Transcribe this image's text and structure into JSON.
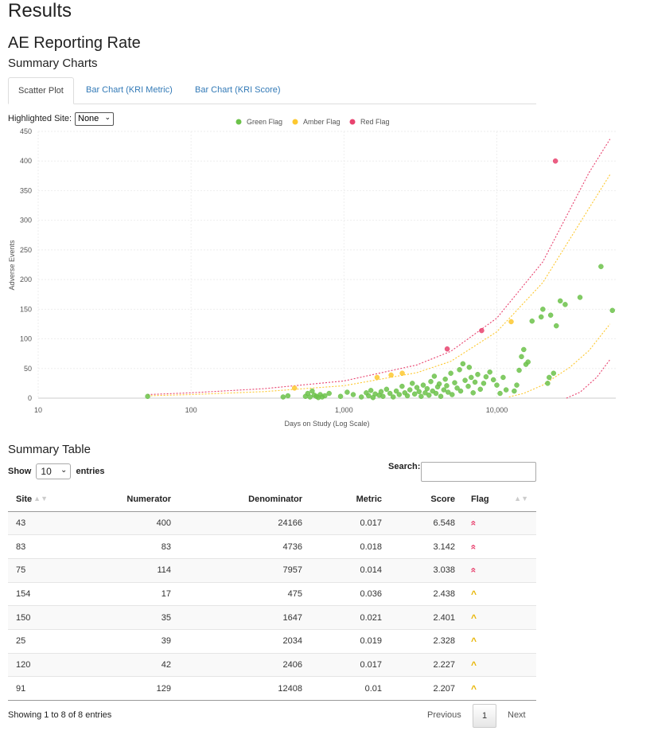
{
  "page": {
    "title": "Results",
    "subtitle": "AE Reporting Rate",
    "charts_heading": "Summary Charts",
    "table_heading": "Summary Table"
  },
  "tabs": [
    {
      "label": "Scatter Plot",
      "active": true
    },
    {
      "label": "Bar Chart (KRI Metric)",
      "active": false
    },
    {
      "label": "Bar Chart (KRI Score)",
      "active": false
    }
  ],
  "highlight": {
    "label": "Highlighted Site:",
    "selected": "None"
  },
  "colors": {
    "green": "#6cc24a",
    "amber": "#fdc82f",
    "red": "#e8436f",
    "link": "#337ab7"
  },
  "chart_data": {
    "type": "scatter",
    "xlabel": "Days on Study (Log Scale)",
    "ylabel": "Adverse Events",
    "x_scale": "log",
    "xlim": [
      10,
      60000
    ],
    "ylim": [
      0,
      450
    ],
    "x_ticks": [
      10,
      100,
      1000,
      10000
    ],
    "x_tick_labels": [
      "10",
      "100",
      "1,000",
      "10,000"
    ],
    "y_ticks": [
      0,
      50,
      100,
      150,
      200,
      250,
      300,
      350,
      400,
      450
    ],
    "grid": true,
    "legend": {
      "placement": "top-center",
      "entries": [
        {
          "name": "Green Flag",
          "color": "#6cc24a"
        },
        {
          "name": "Amber Flag",
          "color": "#fdc82f"
        },
        {
          "name": "Red Flag",
          "color": "#e8436f"
        }
      ]
    },
    "series": [
      {
        "name": "Red Flag",
        "color": "#e8436f",
        "points": [
          {
            "x": 24166,
            "y": 400
          },
          {
            "x": 4736,
            "y": 83
          },
          {
            "x": 7957,
            "y": 114
          }
        ]
      },
      {
        "name": "Amber Flag",
        "color": "#fdc82f",
        "points": [
          {
            "x": 475,
            "y": 17
          },
          {
            "x": 1647,
            "y": 35
          },
          {
            "x": 2034,
            "y": 39
          },
          {
            "x": 2406,
            "y": 42
          },
          {
            "x": 12408,
            "y": 129
          }
        ]
      },
      {
        "name": "Green Flag",
        "color": "#6cc24a",
        "points": [
          {
            "x": 52,
            "y": 3
          },
          {
            "x": 400,
            "y": 2
          },
          {
            "x": 430,
            "y": 4
          },
          {
            "x": 560,
            "y": 3
          },
          {
            "x": 580,
            "y": 8
          },
          {
            "x": 600,
            "y": 2
          },
          {
            "x": 620,
            "y": 12
          },
          {
            "x": 640,
            "y": 5
          },
          {
            "x": 660,
            "y": 3
          },
          {
            "x": 680,
            "y": 1
          },
          {
            "x": 700,
            "y": 6
          },
          {
            "x": 720,
            "y": 2
          },
          {
            "x": 750,
            "y": 4
          },
          {
            "x": 800,
            "y": 8
          },
          {
            "x": 950,
            "y": 3
          },
          {
            "x": 1050,
            "y": 10
          },
          {
            "x": 1150,
            "y": 6
          },
          {
            "x": 1300,
            "y": 2
          },
          {
            "x": 1400,
            "y": 9
          },
          {
            "x": 1450,
            "y": 4
          },
          {
            "x": 1500,
            "y": 13
          },
          {
            "x": 1550,
            "y": 1
          },
          {
            "x": 1600,
            "y": 7
          },
          {
            "x": 1700,
            "y": 5
          },
          {
            "x": 1750,
            "y": 11
          },
          {
            "x": 1800,
            "y": 3
          },
          {
            "x": 1900,
            "y": 15
          },
          {
            "x": 2000,
            "y": 8
          },
          {
            "x": 2100,
            "y": 2
          },
          {
            "x": 2200,
            "y": 12
          },
          {
            "x": 2300,
            "y": 6
          },
          {
            "x": 2400,
            "y": 20
          },
          {
            "x": 2500,
            "y": 9
          },
          {
            "x": 2600,
            "y": 4
          },
          {
            "x": 2700,
            "y": 14
          },
          {
            "x": 2800,
            "y": 25
          },
          {
            "x": 2900,
            "y": 7
          },
          {
            "x": 3000,
            "y": 18
          },
          {
            "x": 3100,
            "y": 11
          },
          {
            "x": 3200,
            "y": 3
          },
          {
            "x": 3300,
            "y": 22
          },
          {
            "x": 3400,
            "y": 9
          },
          {
            "x": 3500,
            "y": 16
          },
          {
            "x": 3600,
            "y": 5
          },
          {
            "x": 3700,
            "y": 28
          },
          {
            "x": 3800,
            "y": 12
          },
          {
            "x": 3900,
            "y": 37
          },
          {
            "x": 4000,
            "y": 8
          },
          {
            "x": 4100,
            "y": 19
          },
          {
            "x": 4200,
            "y": 24
          },
          {
            "x": 4300,
            "y": 3
          },
          {
            "x": 4500,
            "y": 14
          },
          {
            "x": 4600,
            "y": 32
          },
          {
            "x": 4700,
            "y": 21
          },
          {
            "x": 4800,
            "y": 10
          },
          {
            "x": 5000,
            "y": 42
          },
          {
            "x": 5100,
            "y": 6
          },
          {
            "x": 5300,
            "y": 26
          },
          {
            "x": 5500,
            "y": 17
          },
          {
            "x": 5700,
            "y": 48
          },
          {
            "x": 5800,
            "y": 12
          },
          {
            "x": 6000,
            "y": 58
          },
          {
            "x": 6200,
            "y": 30
          },
          {
            "x": 6500,
            "y": 20
          },
          {
            "x": 6600,
            "y": 52
          },
          {
            "x": 6800,
            "y": 35
          },
          {
            "x": 7000,
            "y": 9
          },
          {
            "x": 7200,
            "y": 27
          },
          {
            "x": 7500,
            "y": 40
          },
          {
            "x": 7800,
            "y": 15
          },
          {
            "x": 8200,
            "y": 25
          },
          {
            "x": 8500,
            "y": 36
          },
          {
            "x": 9000,
            "y": 44
          },
          {
            "x": 9500,
            "y": 31
          },
          {
            "x": 10000,
            "y": 22
          },
          {
            "x": 10500,
            "y": 8
          },
          {
            "x": 11000,
            "y": 35
          },
          {
            "x": 11500,
            "y": 14
          },
          {
            "x": 13000,
            "y": 12
          },
          {
            "x": 13500,
            "y": 22
          },
          {
            "x": 14000,
            "y": 47
          },
          {
            "x": 14500,
            "y": 70
          },
          {
            "x": 15000,
            "y": 82
          },
          {
            "x": 15500,
            "y": 57
          },
          {
            "x": 16000,
            "y": 61
          },
          {
            "x": 17000,
            "y": 130
          },
          {
            "x": 19500,
            "y": 137
          },
          {
            "x": 20000,
            "y": 150
          },
          {
            "x": 21500,
            "y": 25
          },
          {
            "x": 22000,
            "y": 35
          },
          {
            "x": 22500,
            "y": 140
          },
          {
            "x": 23500,
            "y": 42
          },
          {
            "x": 24500,
            "y": 122
          },
          {
            "x": 26000,
            "y": 164
          },
          {
            "x": 28000,
            "y": 158
          },
          {
            "x": 35000,
            "y": 170
          },
          {
            "x": 48000,
            "y": 222
          },
          {
            "x": 57000,
            "y": 148
          }
        ]
      }
    ],
    "reference_lines": [
      {
        "name": "upper-red",
        "color": "#e8436f",
        "points": [
          {
            "x": 52,
            "y": 6
          },
          {
            "x": 100,
            "y": 9
          },
          {
            "x": 300,
            "y": 16
          },
          {
            "x": 1000,
            "y": 29
          },
          {
            "x": 3000,
            "y": 56
          },
          {
            "x": 5000,
            "y": 79
          },
          {
            "x": 10000,
            "y": 135
          },
          {
            "x": 20000,
            "y": 230
          },
          {
            "x": 40000,
            "y": 380
          },
          {
            "x": 55000,
            "y": 437
          }
        ]
      },
      {
        "name": "upper-amber",
        "color": "#fdc82f",
        "points": [
          {
            "x": 52,
            "y": 4
          },
          {
            "x": 100,
            "y": 6
          },
          {
            "x": 300,
            "y": 11
          },
          {
            "x": 1000,
            "y": 21
          },
          {
            "x": 3000,
            "y": 43
          },
          {
            "x": 5000,
            "y": 62
          },
          {
            "x": 10000,
            "y": 112
          },
          {
            "x": 20000,
            "y": 195
          },
          {
            "x": 40000,
            "y": 320
          },
          {
            "x": 55000,
            "y": 377
          }
        ]
      },
      {
        "name": "lower-amber",
        "color": "#fdc82f",
        "points": [
          {
            "x": 12000,
            "y": 2
          },
          {
            "x": 15000,
            "y": 8
          },
          {
            "x": 20000,
            "y": 22
          },
          {
            "x": 30000,
            "y": 52
          },
          {
            "x": 40000,
            "y": 80
          },
          {
            "x": 55000,
            "y": 125
          }
        ]
      },
      {
        "name": "lower-red",
        "color": "#e8436f",
        "points": [
          {
            "x": 28500,
            "y": 0
          },
          {
            "x": 35000,
            "y": 10
          },
          {
            "x": 45000,
            "y": 35
          },
          {
            "x": 55000,
            "y": 65
          }
        ]
      }
    ]
  },
  "table": {
    "show_label": "Show",
    "entries_label": "entries",
    "length_value": "10",
    "search_label": "Search:",
    "columns": [
      "Site",
      "Numerator",
      "Denominator",
      "Metric",
      "Score",
      "Flag"
    ],
    "rows": [
      {
        "site": "43",
        "numerator": "400",
        "denominator": "24166",
        "metric": "0.017",
        "score": "6.548",
        "flag": "red"
      },
      {
        "site": "83",
        "numerator": "83",
        "denominator": "4736",
        "metric": "0.018",
        "score": "3.142",
        "flag": "red"
      },
      {
        "site": "75",
        "numerator": "114",
        "denominator": "7957",
        "metric": "0.014",
        "score": "3.038",
        "flag": "red"
      },
      {
        "site": "154",
        "numerator": "17",
        "denominator": "475",
        "metric": "0.036",
        "score": "2.438",
        "flag": "amber"
      },
      {
        "site": "150",
        "numerator": "35",
        "denominator": "1647",
        "metric": "0.021",
        "score": "2.401",
        "flag": "amber"
      },
      {
        "site": "25",
        "numerator": "39",
        "denominator": "2034",
        "metric": "0.019",
        "score": "2.328",
        "flag": "amber"
      },
      {
        "site": "120",
        "numerator": "42",
        "denominator": "2406",
        "metric": "0.017",
        "score": "2.227",
        "flag": "amber"
      },
      {
        "site": "91",
        "numerator": "129",
        "denominator": "12408",
        "metric": "0.01",
        "score": "2.207",
        "flag": "amber"
      }
    ],
    "info": "Showing 1 to 8 of 8 entries",
    "pagination": {
      "previous": "Previous",
      "current": "1",
      "next": "Next"
    },
    "flag_glyphs": {
      "red": "«",
      "amber": "^"
    }
  }
}
